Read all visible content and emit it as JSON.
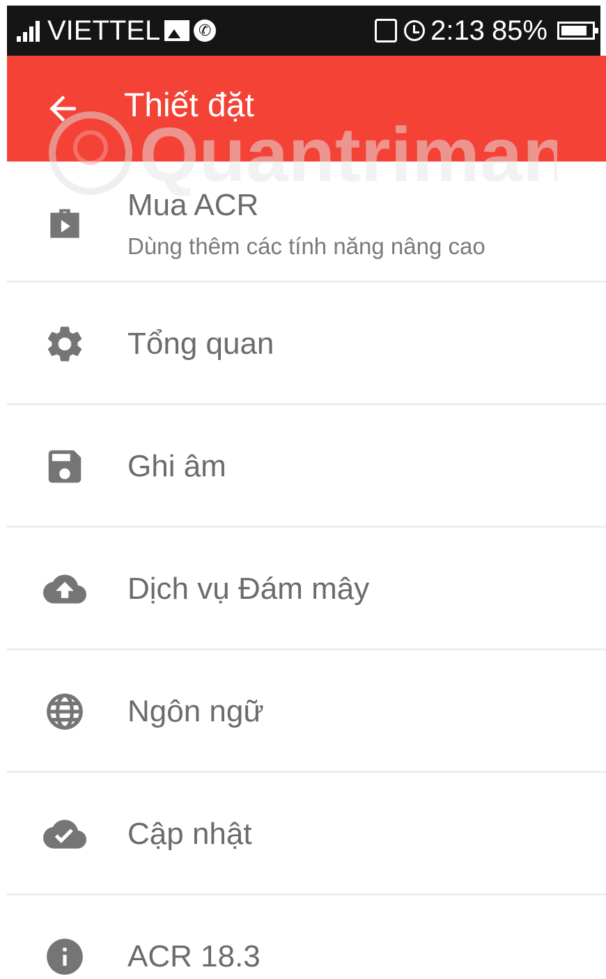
{
  "status_bar": {
    "carrier": "VIETTEL",
    "time": "2:13",
    "battery": "85%",
    "battery_level": 0.85
  },
  "app_bar": {
    "title": "Thiết đặt",
    "color": "#f44336"
  },
  "watermark": "Quantrimang",
  "settings": [
    {
      "label": "Mua ACR",
      "sublabel": "Dùng thêm các tính năng nâng cao",
      "icon": "store-icon"
    },
    {
      "label": "Tổng quan",
      "icon": "gear-icon"
    },
    {
      "label": "Ghi âm",
      "icon": "save-icon"
    },
    {
      "label": "Dịch vụ Đám mây",
      "icon": "cloud-upload-icon"
    },
    {
      "label": "Ngôn ngữ",
      "icon": "globe-icon"
    },
    {
      "label": "Cập nhật",
      "icon": "cloud-check-icon"
    },
    {
      "label": "ACR 18.3",
      "icon": "info-icon"
    }
  ]
}
